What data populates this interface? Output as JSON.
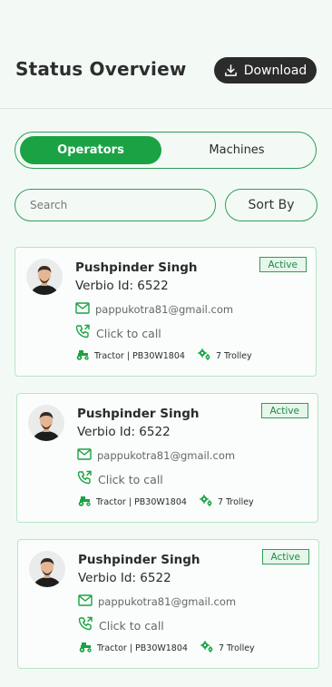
{
  "header": {
    "title": "Status Overview",
    "download_label": "Download"
  },
  "tabs": [
    {
      "label": "Operators",
      "active": true
    },
    {
      "label": "Machines",
      "active": false
    }
  ],
  "search": {
    "placeholder": "Search"
  },
  "sort": {
    "label": "Sort By"
  },
  "colors": {
    "accent": "#1ba244",
    "dark": "#2b2b2b",
    "background": "#f3faf6"
  },
  "operators": [
    {
      "name": "Pushpinder Singh",
      "verbio_id": "Verbio Id: 6522",
      "status": "Active",
      "email": "pappukotra81@gmail.com",
      "call_label": "Click to call",
      "vehicle": "Tractor | PB30W1804",
      "trolley": "7 Trolley"
    },
    {
      "name": "Pushpinder Singh",
      "verbio_id": "Verbio Id: 6522",
      "status": "Active",
      "email": "pappukotra81@gmail.com",
      "call_label": "Click to call",
      "vehicle": "Tractor | PB30W1804",
      "trolley": "7 Trolley"
    },
    {
      "name": "Pushpinder Singh",
      "verbio_id": "Verbio Id: 6522",
      "status": "Active",
      "email": "pappukotra81@gmail.com",
      "call_label": "Click to call",
      "vehicle": "Tractor | PB30W1804",
      "trolley": "7 Trolley"
    }
  ]
}
